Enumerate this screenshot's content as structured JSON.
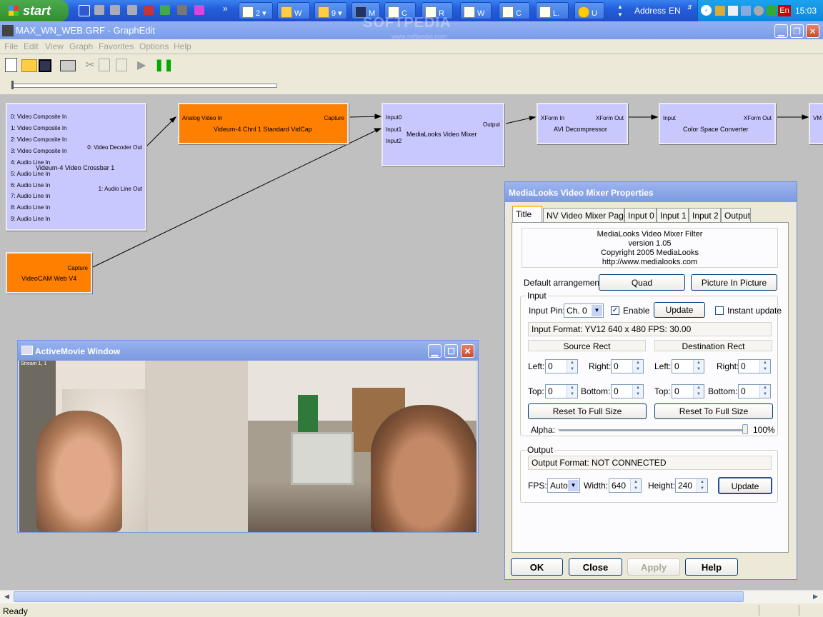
{
  "taskbar": {
    "start_label": "start",
    "buttons": [
      {
        "label": "2",
        "icon": "palette-icon"
      },
      {
        "label": "W",
        "icon": "folder-icon"
      },
      {
        "label": "9",
        "icon": "folder-icon"
      },
      {
        "label": "M",
        "icon": "help-icon"
      },
      {
        "label": "C",
        "icon": "computer-icon"
      },
      {
        "label": "R",
        "icon": "graph-icon"
      },
      {
        "label": "W",
        "icon": "help-icon"
      },
      {
        "label": "C",
        "icon": "document-icon"
      },
      {
        "label": "L",
        "icon": "graph-icon"
      },
      {
        "label": "U",
        "icon": "app-icon"
      }
    ],
    "address_label": "Address",
    "lang": "EN",
    "tray_lang": "En",
    "clock": "15:03"
  },
  "watermark": {
    "main": "SOFTPEDIA",
    "sub": "www.softpedia.com"
  },
  "window": {
    "title": "MAX_WN_WEB.GRF - GraphEdit"
  },
  "menu": [
    "File",
    "Edit",
    "View",
    "Graph",
    "Favorites",
    "Options",
    "Help"
  ],
  "graph": {
    "crossbar": {
      "name": "Videum-4 Video Crossbar 1",
      "inputs": [
        "0: Video Composite In",
        "1: Video Composite In",
        "2: Video Composite In",
        "3: Video Composite In",
        "4: Audio Line In",
        "5: Audio Line In",
        "6: Audio Line In",
        "7: Audio Line In",
        "8: Audio Line In",
        "9: Audio Line In"
      ],
      "outputs": [
        "0: Video Decoder Out",
        "1: Audio Line Out"
      ]
    },
    "vidcap": {
      "name": "Videum-4 Chnl 1 Standard VidCap",
      "in_pin": "Analog Video In",
      "out_pin": "Capture"
    },
    "webcam": {
      "name": "VideoCAM Web V4",
      "out_pin": "Capture"
    },
    "mixer": {
      "name": "MediaLooks Video Mixer",
      "inputs": [
        "Input0",
        "Input1",
        "Input2"
      ],
      "out_pin": "Output"
    },
    "avi": {
      "name": "AVI Decompressor",
      "in_pin": "XForm In",
      "out_pin": "XForm Out"
    },
    "csc": {
      "name": "Color Space Converter",
      "in_pin": "Input",
      "out_pin": "XForm Out"
    },
    "vmr": {
      "in_pin": "VM"
    }
  },
  "dialog": {
    "title": "MediaLooks Video Mixer Properties",
    "tabs": [
      "Title",
      "NV Video Mixer Page",
      "Input 0",
      "Input 1",
      "Input 2",
      "Output"
    ],
    "info": [
      "MediaLooks Video Mixer Filter",
      "version 1.05",
      "Copyright 2005 MediaLooks",
      "http://www.medialooks.com"
    ],
    "default_arrangement_label": "Default arrangement:",
    "quad_button": "Quad",
    "pip_button": "Picture In Picture",
    "input_group": "Input",
    "input_pin_label": "Input Pin:",
    "input_pin_value": "Ch. 0",
    "enable_label": "Enable",
    "update_button": "Update",
    "instant_update_label": "Instant update",
    "input_format": "Input Format: YV12  640 x 480  FPS: 30.00",
    "source_rect": "Source Rect",
    "dest_rect": "Destination Rect",
    "left_label": "Left:",
    "right_label": "Right:",
    "top_label": "Top:",
    "bottom_label": "Bottom:",
    "src_left": "0",
    "src_right": "0",
    "src_top": "0",
    "src_bottom": "0",
    "dst_left": "0",
    "dst_right": "0",
    "dst_top": "0",
    "dst_bottom": "0",
    "reset_button": "Reset To Full Size",
    "alpha_label": "Alpha:",
    "alpha_value": "100%",
    "alpha_level": 1.0,
    "output_group": "Output",
    "output_format": "Output Format: NOT CONNECTED",
    "fps_label": "FPS:",
    "fps_value": "Auto",
    "width_label": "Width:",
    "width_value": "640",
    "height_label": "Height:",
    "height_value": "240",
    "output_update_button": "Update",
    "ok_button": "OK",
    "close_button": "Close",
    "apply_button": "Apply",
    "help_button": "Help"
  },
  "activemovie": {
    "title": "ActiveMovie Window",
    "overlay_text": "Stream 1, 1"
  },
  "status": {
    "text": "Ready"
  }
}
